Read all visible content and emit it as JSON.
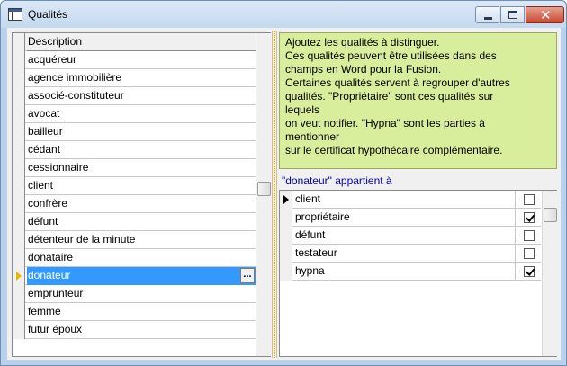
{
  "window": {
    "title": "Qualités",
    "close_glyph": "✕"
  },
  "left_grid": {
    "header": "Description",
    "rows": [
      "acquéreur",
      "agence immobilière",
      "associé-constituteur",
      "avocat",
      "bailleur",
      "cédant",
      "cessionnaire",
      "client",
      "confrère",
      "défunt",
      "détenteur de la minute",
      "donataire",
      "donateur",
      "emprunteur",
      "femme",
      "futur époux"
    ],
    "active_row": "donateur",
    "ellipsis": "...",
    "scroll_thumb_fraction": 0.48
  },
  "info": {
    "lines": [
      "Ajoutez les qualités à distinguer.",
      "Ces qualités peuvent être utilisées dans des",
      "champs en Word pour la Fusion.",
      "Certaines qualités servent à regrouper d'autres",
      "qualités.  \"Propriétaire\" sont ces qualités sur",
      "lequels",
      "on veut notifier.  \"Hypna\" sont les parties à",
      "mentionner",
      "sur le certificat hypothécaire complémentaire."
    ],
    "background": "#d9ee9c"
  },
  "belongs_label": "\"donateur\" appartient à",
  "right_grid": {
    "rows": [
      {
        "label": "client",
        "checked": false,
        "current": true
      },
      {
        "label": "propriétaire",
        "checked": true,
        "current": false
      },
      {
        "label": "défunt",
        "checked": false,
        "current": false
      },
      {
        "label": "testateur",
        "checked": false,
        "current": false
      },
      {
        "label": "hypna",
        "checked": true,
        "current": false
      }
    ]
  },
  "colors": {
    "selection": "#3399ff",
    "link_text": "#0000aa",
    "row_pointer": "#e6b800"
  }
}
